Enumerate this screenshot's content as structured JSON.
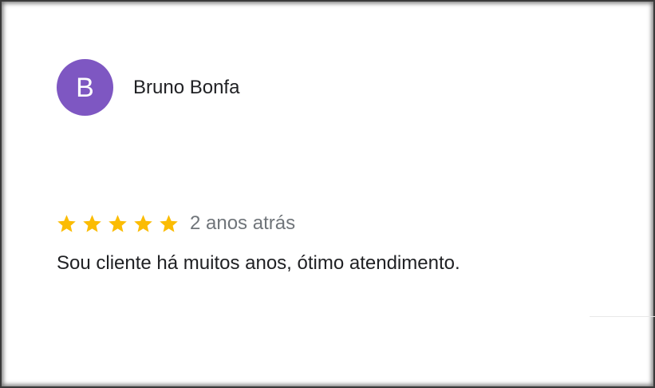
{
  "review": {
    "author": {
      "initial": "B",
      "name": "Bruno Bonfa",
      "avatar_color": "#7e57c2"
    },
    "rating": {
      "stars": 5,
      "max": 5,
      "star_color": "#fbbc04",
      "icon": "star-icon"
    },
    "time_ago": "2 anos atrás",
    "text": "Sou cliente há muitos anos, ótimo atendimento."
  }
}
